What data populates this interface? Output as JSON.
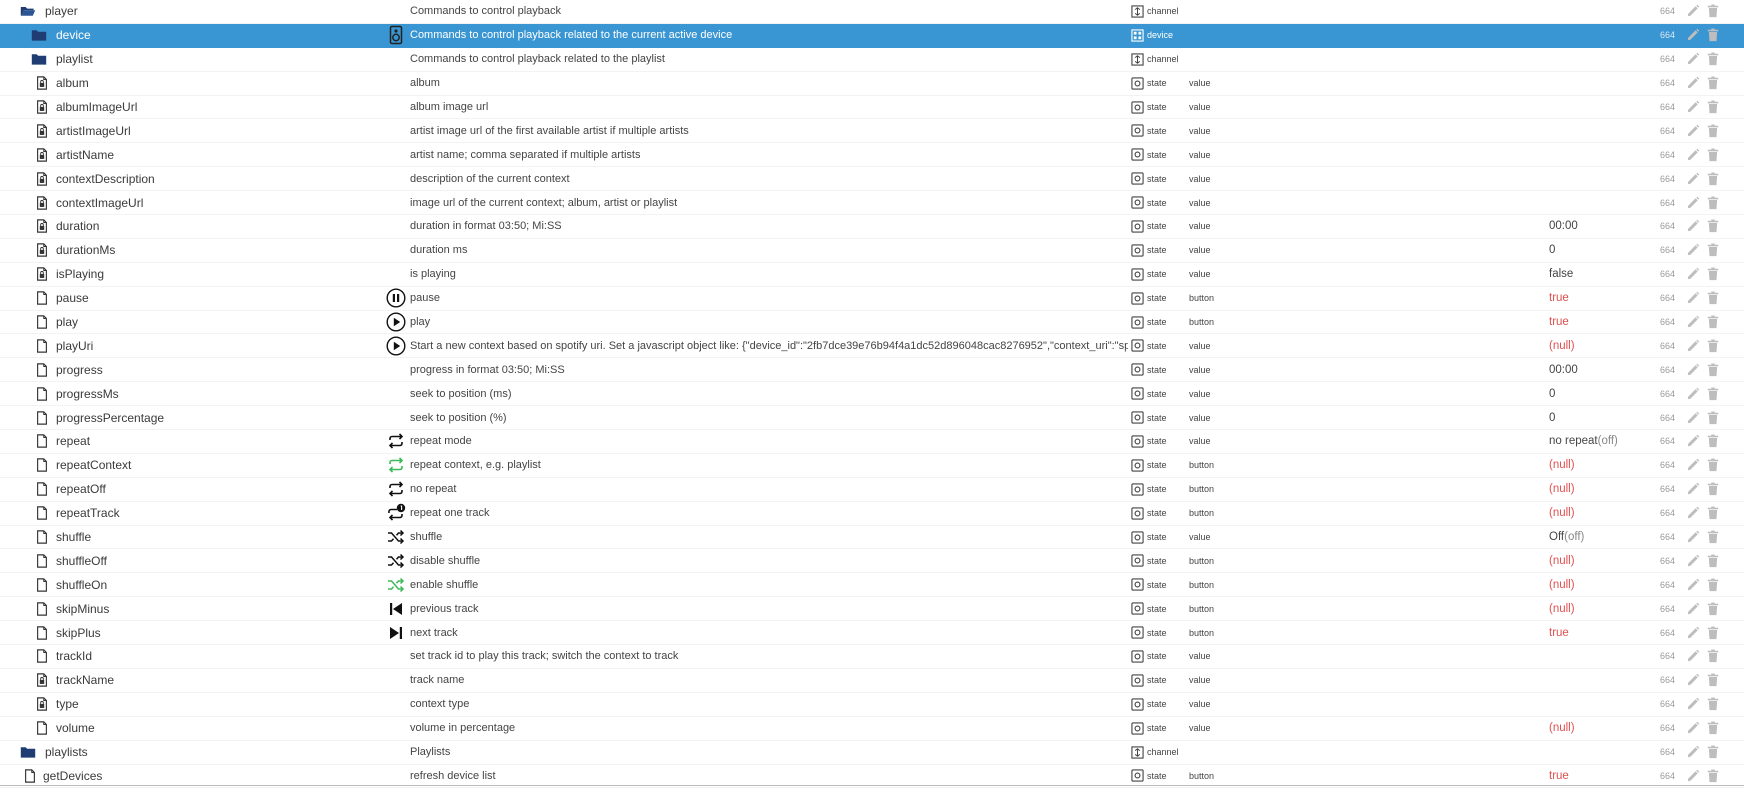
{
  "colors": {
    "selected_row": "#3a96d2",
    "folder_icon": "#1f3d73",
    "null_or_true_value": "#e05050",
    "green_icon": "#3cb85a"
  },
  "rows": [
    {
      "level": 0,
      "node_icon": "folder-open-icon",
      "name": "player",
      "row_icon": "",
      "desc": "Commands to control playback",
      "type_icon": "channel-icon",
      "type": "channel",
      "role": "",
      "value": "",
      "value_sub": "",
      "value_color": "",
      "acl": "664",
      "selected": false
    },
    {
      "level": 1,
      "node_icon": "folder-icon",
      "name": "device",
      "row_icon": "speaker-icon",
      "desc": "Commands to control playback related to the current active device",
      "type_icon": "device-icon",
      "type": "device",
      "role": "",
      "value": "",
      "value_sub": "",
      "value_color": "",
      "acl": "664",
      "selected": true
    },
    {
      "level": 1,
      "node_icon": "folder-icon",
      "name": "playlist",
      "row_icon": "",
      "desc": "Commands to control playback related to the playlist",
      "type_icon": "channel-icon",
      "type": "channel",
      "role": "",
      "value": "",
      "value_sub": "",
      "value_color": "",
      "acl": "664",
      "selected": false
    },
    {
      "level": 1,
      "node_icon": "file-lock-icon",
      "name": "album",
      "row_icon": "",
      "desc": "album",
      "type_icon": "state-icon",
      "type": "state",
      "role": "value",
      "value": "",
      "value_sub": "",
      "value_color": "",
      "acl": "664",
      "selected": false
    },
    {
      "level": 1,
      "node_icon": "file-lock-icon",
      "name": "albumImageUrl",
      "row_icon": "",
      "desc": "album image url",
      "type_icon": "state-icon",
      "type": "state",
      "role": "value",
      "value": "",
      "value_sub": "",
      "value_color": "",
      "acl": "664",
      "selected": false
    },
    {
      "level": 1,
      "node_icon": "file-lock-icon",
      "name": "artistImageUrl",
      "row_icon": "",
      "desc": "artist image url of the first available artist if multiple artists",
      "type_icon": "state-icon",
      "type": "state",
      "role": "value",
      "value": "",
      "value_sub": "",
      "value_color": "",
      "acl": "664",
      "selected": false
    },
    {
      "level": 1,
      "node_icon": "file-lock-icon",
      "name": "artistName",
      "row_icon": "",
      "desc": "artist name; comma separated if multiple artists",
      "type_icon": "state-icon",
      "type": "state",
      "role": "value",
      "value": "",
      "value_sub": "",
      "value_color": "",
      "acl": "664",
      "selected": false
    },
    {
      "level": 1,
      "node_icon": "file-lock-icon",
      "name": "contextDescription",
      "row_icon": "",
      "desc": "description of the current context",
      "type_icon": "state-icon",
      "type": "state",
      "role": "value",
      "value": "",
      "value_sub": "",
      "value_color": "",
      "acl": "664",
      "selected": false
    },
    {
      "level": 1,
      "node_icon": "file-lock-icon",
      "name": "contextImageUrl",
      "row_icon": "",
      "desc": "image url of the current context; album, artist or playlist",
      "type_icon": "state-icon",
      "type": "state",
      "role": "value",
      "value": "",
      "value_sub": "",
      "value_color": "",
      "acl": "664",
      "selected": false
    },
    {
      "level": 1,
      "node_icon": "file-lock-icon",
      "name": "duration",
      "row_icon": "",
      "desc": "duration in format 03:50; Mi:SS",
      "type_icon": "state-icon",
      "type": "state",
      "role": "value",
      "value": "00:00",
      "value_sub": "",
      "value_color": "",
      "acl": "664",
      "selected": false
    },
    {
      "level": 1,
      "node_icon": "file-lock-icon",
      "name": "durationMs",
      "row_icon": "",
      "desc": "duration ms",
      "type_icon": "state-icon",
      "type": "state",
      "role": "value",
      "value": "0",
      "value_sub": "",
      "value_color": "",
      "acl": "664",
      "selected": false
    },
    {
      "level": 1,
      "node_icon": "file-lock-icon",
      "name": "isPlaying",
      "row_icon": "",
      "desc": "is playing",
      "type_icon": "state-icon",
      "type": "state",
      "role": "value",
      "value": "false",
      "value_sub": "",
      "value_color": "",
      "acl": "664",
      "selected": false
    },
    {
      "level": 1,
      "node_icon": "file-icon",
      "name": "pause",
      "row_icon": "pause-icon",
      "desc": "pause",
      "type_icon": "state-icon",
      "type": "state",
      "role": "button",
      "value": "true",
      "value_sub": "",
      "value_color": "red",
      "acl": "664",
      "selected": false
    },
    {
      "level": 1,
      "node_icon": "file-icon",
      "name": "play",
      "row_icon": "play-icon",
      "desc": "play",
      "type_icon": "state-icon",
      "type": "state",
      "role": "button",
      "value": "true",
      "value_sub": "",
      "value_color": "red",
      "acl": "664",
      "selected": false
    },
    {
      "level": 1,
      "node_icon": "file-icon",
      "name": "playUri",
      "row_icon": "play-icon",
      "desc": "Start a new context based on spotify uri. Set a javascript object like: {\"device_id\":\"2fb7dce39e76b94f4a1dc52d896048cac8276952\",\"context_uri\":\"spotify:us...",
      "type_icon": "state-icon",
      "type": "state",
      "role": "value",
      "value": "(null)",
      "value_sub": "",
      "value_color": "red",
      "acl": "664",
      "selected": false
    },
    {
      "level": 1,
      "node_icon": "file-icon",
      "name": "progress",
      "row_icon": "",
      "desc": "progress in format 03:50; Mi:SS",
      "type_icon": "state-icon",
      "type": "state",
      "role": "value",
      "value": "00:00",
      "value_sub": "",
      "value_color": "",
      "acl": "664",
      "selected": false
    },
    {
      "level": 1,
      "node_icon": "file-icon",
      "name": "progressMs",
      "row_icon": "",
      "desc": "seek to position (ms)",
      "type_icon": "state-icon",
      "type": "state",
      "role": "value",
      "value": "0",
      "value_sub": "",
      "value_color": "",
      "acl": "664",
      "selected": false
    },
    {
      "level": 1,
      "node_icon": "file-icon",
      "name": "progressPercentage",
      "row_icon": "",
      "desc": "seek to position (%)",
      "type_icon": "state-icon",
      "type": "state",
      "role": "value",
      "value": "0",
      "value_sub": "",
      "value_color": "",
      "acl": "664",
      "selected": false
    },
    {
      "level": 1,
      "node_icon": "file-icon",
      "name": "repeat",
      "row_icon": "repeat-icon",
      "desc": "repeat mode",
      "type_icon": "state-icon",
      "type": "state",
      "role": "value",
      "value": "no repeat",
      "value_sub": "(off)",
      "value_color": "",
      "acl": "664",
      "selected": false
    },
    {
      "level": 1,
      "node_icon": "file-icon",
      "name": "repeatContext",
      "row_icon": "repeat-green-icon",
      "desc": "repeat context, e.g. playlist",
      "type_icon": "state-icon",
      "type": "state",
      "role": "button",
      "value": "(null)",
      "value_sub": "",
      "value_color": "red",
      "acl": "664",
      "selected": false
    },
    {
      "level": 1,
      "node_icon": "file-icon",
      "name": "repeatOff",
      "row_icon": "repeat-icon",
      "desc": "no repeat",
      "type_icon": "state-icon",
      "type": "state",
      "role": "button",
      "value": "(null)",
      "value_sub": "",
      "value_color": "red",
      "acl": "664",
      "selected": false
    },
    {
      "level": 1,
      "node_icon": "file-icon",
      "name": "repeatTrack",
      "row_icon": "repeat-one-icon",
      "desc": "repeat one track",
      "type_icon": "state-icon",
      "type": "state",
      "role": "button",
      "value": "(null)",
      "value_sub": "",
      "value_color": "red",
      "acl": "664",
      "selected": false
    },
    {
      "level": 1,
      "node_icon": "file-icon",
      "name": "shuffle",
      "row_icon": "shuffle-icon",
      "desc": "shuffle",
      "type_icon": "state-icon",
      "type": "state",
      "role": "value",
      "value": "Off",
      "value_sub": "(off)",
      "value_color": "",
      "acl": "664",
      "selected": false
    },
    {
      "level": 1,
      "node_icon": "file-icon",
      "name": "shuffleOff",
      "row_icon": "shuffle-icon",
      "desc": "disable shuffle",
      "type_icon": "state-icon",
      "type": "state",
      "role": "button",
      "value": "(null)",
      "value_sub": "",
      "value_color": "red",
      "acl": "664",
      "selected": false
    },
    {
      "level": 1,
      "node_icon": "file-icon",
      "name": "shuffleOn",
      "row_icon": "shuffle-green-icon",
      "desc": "enable shuffle",
      "type_icon": "state-icon",
      "type": "state",
      "role": "button",
      "value": "(null)",
      "value_sub": "",
      "value_color": "red",
      "acl": "664",
      "selected": false
    },
    {
      "level": 1,
      "node_icon": "file-icon",
      "name": "skipMinus",
      "row_icon": "skip-previous-icon",
      "desc": "previous track",
      "type_icon": "state-icon",
      "type": "state",
      "role": "button",
      "value": "(null)",
      "value_sub": "",
      "value_color": "red",
      "acl": "664",
      "selected": false
    },
    {
      "level": 1,
      "node_icon": "file-icon",
      "name": "skipPlus",
      "row_icon": "skip-next-icon",
      "desc": "next track",
      "type_icon": "state-icon",
      "type": "state",
      "role": "button",
      "value": "true",
      "value_sub": "",
      "value_color": "red",
      "acl": "664",
      "selected": false
    },
    {
      "level": 1,
      "node_icon": "file-icon",
      "name": "trackId",
      "row_icon": "",
      "desc": "set track id to play this track; switch the context to track",
      "type_icon": "state-icon",
      "type": "state",
      "role": "value",
      "value": "",
      "value_sub": "",
      "value_color": "",
      "acl": "664",
      "selected": false
    },
    {
      "level": 1,
      "node_icon": "file-lock-icon",
      "name": "trackName",
      "row_icon": "",
      "desc": "track name",
      "type_icon": "state-icon",
      "type": "state",
      "role": "value",
      "value": "",
      "value_sub": "",
      "value_color": "",
      "acl": "664",
      "selected": false
    },
    {
      "level": 1,
      "node_icon": "file-lock-icon",
      "name": "type",
      "row_icon": "",
      "desc": "context type",
      "type_icon": "state-icon",
      "type": "state",
      "role": "value",
      "value": "",
      "value_sub": "",
      "value_color": "",
      "acl": "664",
      "selected": false
    },
    {
      "level": 1,
      "node_icon": "file-icon",
      "name": "volume",
      "row_icon": "",
      "desc": "volume in percentage",
      "type_icon": "state-icon",
      "type": "state",
      "role": "value",
      "value": "(null)",
      "value_sub": "",
      "value_color": "red",
      "acl": "664",
      "selected": false
    },
    {
      "level": 0,
      "node_icon": "folder-icon",
      "name": "playlists",
      "row_icon": "",
      "desc": "Playlists",
      "type_icon": "channel-icon",
      "type": "channel",
      "role": "",
      "value": "",
      "value_sub": "",
      "value_color": "",
      "acl": "664",
      "selected": false
    },
    {
      "level": 0,
      "node_icon": "file-icon",
      "name": "getDevices",
      "row_icon": "",
      "desc": "refresh device list",
      "type_icon": "state-icon",
      "type": "state",
      "role": "button",
      "value": "true",
      "value_sub": "",
      "value_color": "red",
      "acl": "664",
      "selected": false
    }
  ]
}
